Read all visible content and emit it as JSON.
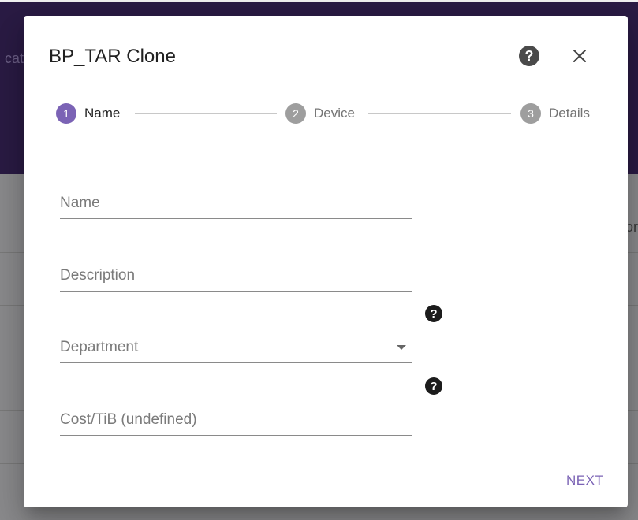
{
  "background": {
    "left_fragment": "cati",
    "right_fragment": "or"
  },
  "dialog": {
    "title": "BP_TAR Clone",
    "help_icon": "question-circle-icon",
    "close_icon": "close-icon"
  },
  "stepper": {
    "steps": [
      {
        "number": "1",
        "label": "Name",
        "state": "active"
      },
      {
        "number": "2",
        "label": "Device",
        "state": "inactive"
      },
      {
        "number": "3",
        "label": "Details",
        "state": "inactive"
      }
    ],
    "active_color": "#7b63b5",
    "inactive_color": "#9e9e9e"
  },
  "form": {
    "name_placeholder": "Name",
    "description_placeholder": "Description",
    "department_label": "Department",
    "cost_placeholder": "Cost/TiB (undefined)"
  },
  "actions": {
    "next_label": "NEXT"
  },
  "colors": {
    "accent": "#7b63b5",
    "header_bg": "#2a1b44"
  }
}
